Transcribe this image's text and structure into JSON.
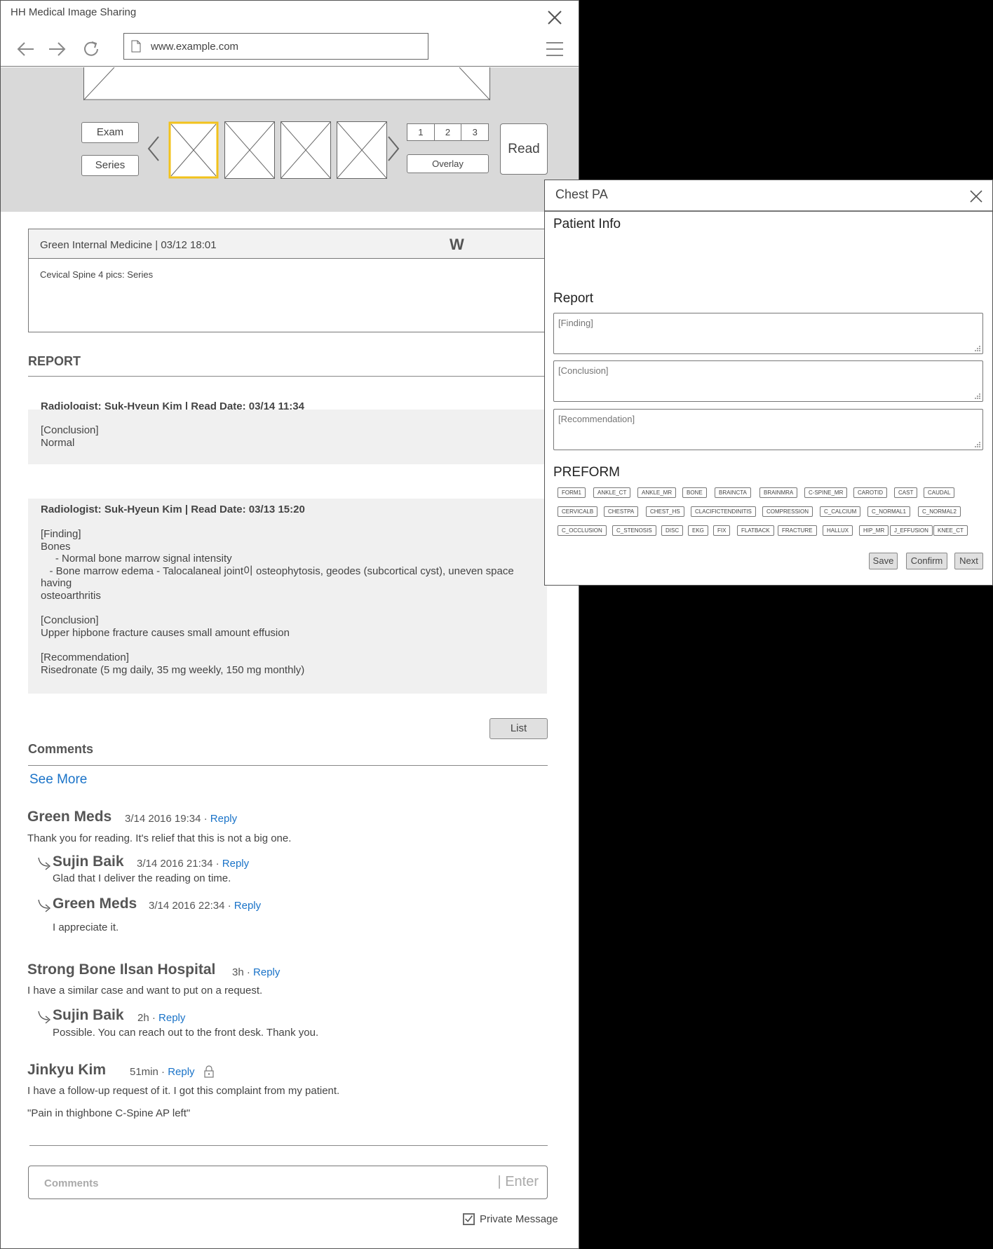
{
  "window": {
    "title": "HH Medical Image Sharing"
  },
  "browser": {
    "url": "www.example.com"
  },
  "viewer": {
    "exam_label": "Exam",
    "series_label": "Series",
    "pages": [
      "1",
      "2",
      "3"
    ],
    "overlay_label": "Overlay",
    "read_label": "Read"
  },
  "info": {
    "header": "Green Internal Medicine |  03/12 18:01",
    "badge": "W",
    "body": "Cevical Spine 4 pics: Series"
  },
  "report": {
    "title": "REPORT",
    "entries": [
      {
        "header": "Radiologist: Suk-Hyeun Kim | Read Date: 03/14 11:34",
        "lines": [
          "[Conclusion]",
          "Normal"
        ]
      },
      {
        "header": "Radiologist: Suk-Hyeun Kim | Read Date: 03/13 15:20",
        "lines": [
          "[Finding]",
          "Bones",
          "     - Normal bone marrow signal intensity",
          "   - Bone marrow edema - Talocalaneal joint이 osteophytosis, geodes (subcortical cyst), uneven space having",
          "osteoarthritis",
          "",
          "[Conclusion]",
          "Upper hipbone fracture causes small amount effusion",
          "",
          "[Recommendation]",
          "Risedronate (5 mg daily, 35 mg weekly, 150 mg monthly)"
        ]
      }
    ],
    "list_label": "List"
  },
  "comments": {
    "title": "Comments",
    "see_more": "See More",
    "reply_label": "Reply",
    "items": [
      {
        "name": "Green Meds",
        "time": "3/14 2016 19:34 · ",
        "text": "Thank you for reading. It's relief that this is not a big one."
      },
      {
        "name": "Sujin Baik",
        "time": "3/14 2016 21:34 · ",
        "text": "Glad that I deliver the reading on time."
      },
      {
        "name": "Green Meds",
        "time": "3/14 2016 22:34 · ",
        "text": "I appreciate it."
      },
      {
        "name": "Strong Bone Ilsan Hospital",
        "time": "3h · ",
        "text": "I have a similar case and want to put on a request."
      },
      {
        "name": "Sujin Baik",
        "time": "2h · ",
        "text": "Possible. You can reach out to the front desk. Thank you."
      },
      {
        "name": "Jinkyu Kim",
        "time": "51min · ",
        "text": "I have a follow-up request of it. I got this complaint from my patient.",
        "quote": "\"Pain in thighbone C-Spine AP left\""
      }
    ],
    "input_placeholder": "Comments",
    "enter_label": "| Enter",
    "private_label": "Private Message",
    "private_checked": true
  },
  "dialog": {
    "title": "Chest PA",
    "patient_info_label": "Patient Info",
    "report_label": "Report",
    "finding_placeholder": "[Finding]",
    "conclusion_placeholder": "[Conclusion]",
    "recommendation_placeholder": "[Recommendation]",
    "preform_label": "PREFORM",
    "tags": [
      [
        "FORM1",
        "ANKLE_CT",
        "ANKLE_MR",
        "BONE",
        "BRAINCTA",
        "BRAINMRA",
        "C-SPINE_MR",
        "CAROTID",
        "CAST",
        "CAUDAL"
      ],
      [
        "CERVICALB",
        "CHESTPA",
        "CHEST_HS",
        "CLACIFICTENDINITIS",
        "COMPRESSION",
        "C_CALCIUM",
        "C_NORMAL1",
        "C_NORMAL2"
      ],
      [
        "C_OCCLUSION",
        "C_STENOSIS",
        "DISC",
        "EKG",
        "FIX",
        "FLATBACK",
        "FRACTURE",
        "HALLUX",
        "HIP_MR",
        "J_EFFUSION",
        "KNEE_CT"
      ]
    ],
    "save_label": "Save",
    "confirm_label": "Confirm",
    "next_label": "Next"
  },
  "colors": {
    "accent": "#1a73c8",
    "selected_thumb": "#f2c21b",
    "viewer_bg": "#d9d9d9"
  }
}
